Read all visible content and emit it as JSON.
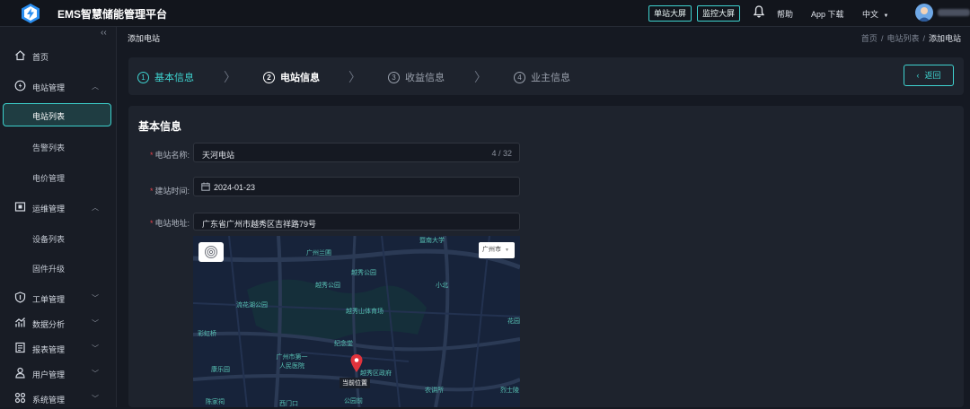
{
  "app": {
    "title": "EMS智慧储能管理平台"
  },
  "header": {
    "btn_single": "单站大屏",
    "btn_monitor": "监控大屏",
    "help": "帮助",
    "app_download": "App 下载",
    "language": "中文"
  },
  "sidebar": {
    "collapse": "‹‹",
    "home": "首页",
    "station_mgmt": "电站管理",
    "station_list": "电站列表",
    "alarm_list": "告警列表",
    "price_mgmt": "电价管理",
    "ops_mgmt": "运维管理",
    "device_list": "设备列表",
    "firmware": "固件升级",
    "ticket_mgmt": "工单管理",
    "data_analysis": "数据分析",
    "report_mgmt": "报表管理",
    "user_mgmt": "用户管理",
    "system_mgmt": "系统管理"
  },
  "breadcrumb": {
    "page_title": "添加电站",
    "home": "首页",
    "list": "电站列表",
    "current": "添加电站",
    "sep": "/"
  },
  "steps": [
    {
      "num": "1",
      "label": "基本信息"
    },
    {
      "num": "2",
      "label": "电站信息"
    },
    {
      "num": "3",
      "label": "收益信息"
    },
    {
      "num": "4",
      "label": "业主信息"
    }
  ],
  "back_button": "返回",
  "form": {
    "title": "基本信息",
    "required_mark": "*",
    "name_label": "电站名称:",
    "name_value": "天河电站",
    "name_count": "4 / 32",
    "date_label": "建站时间:",
    "date_value": "2024-01-23",
    "address_label": "电站地址:",
    "address_value": "广东省广州市越秀区吉祥路79号"
  },
  "map": {
    "city_select": "广州市",
    "pin_label": "当前位置",
    "labels": [
      "广州兰圃",
      "越秀公园",
      "越秀公园",
      "小北",
      "流花湖公园",
      "越秀山体育场",
      "彩虹桥",
      "纪念堂",
      "广州市第一人民医院",
      "康乐园",
      "越秀区政府",
      "农讲所",
      "陈家祠",
      "西门口",
      "公园前",
      "烈士陵",
      "花园",
      "暨南大学"
    ]
  },
  "colors": {
    "accent": "#3fd3d0",
    "required": "#e2424b",
    "pin": "#e0333c"
  }
}
